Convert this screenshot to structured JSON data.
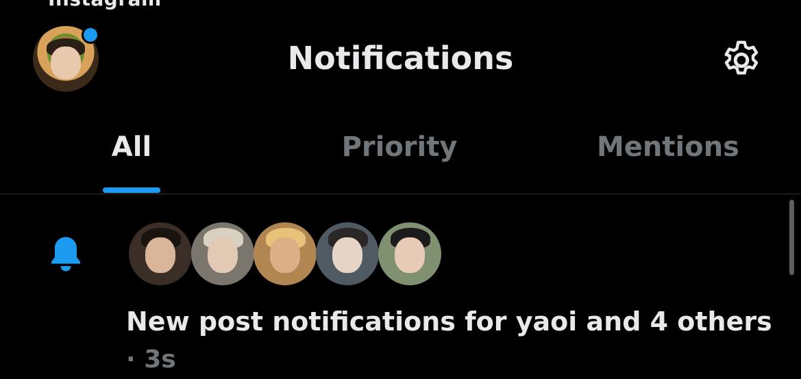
{
  "status_bar": {
    "back_app_label": "Instagram"
  },
  "header": {
    "title": "Notifications",
    "avatar_icon": "profile-avatar",
    "settings_icon": "gear-icon",
    "notification_dot_color": "#1d9bf0"
  },
  "tabs": [
    {
      "label": "All",
      "active": true
    },
    {
      "label": "Priority",
      "active": false
    },
    {
      "label": "Mentions",
      "active": false
    }
  ],
  "colors": {
    "accent": "#1d9bf0",
    "background": "#000000",
    "text_primary": "#e7e9ea",
    "text_secondary": "#71767b",
    "divider": "#2f3336"
  },
  "notification": {
    "icon": "bell-icon",
    "avatar_count": 5,
    "text": "New post notifications for yaoi and 4 others",
    "time": "· 3s"
  }
}
